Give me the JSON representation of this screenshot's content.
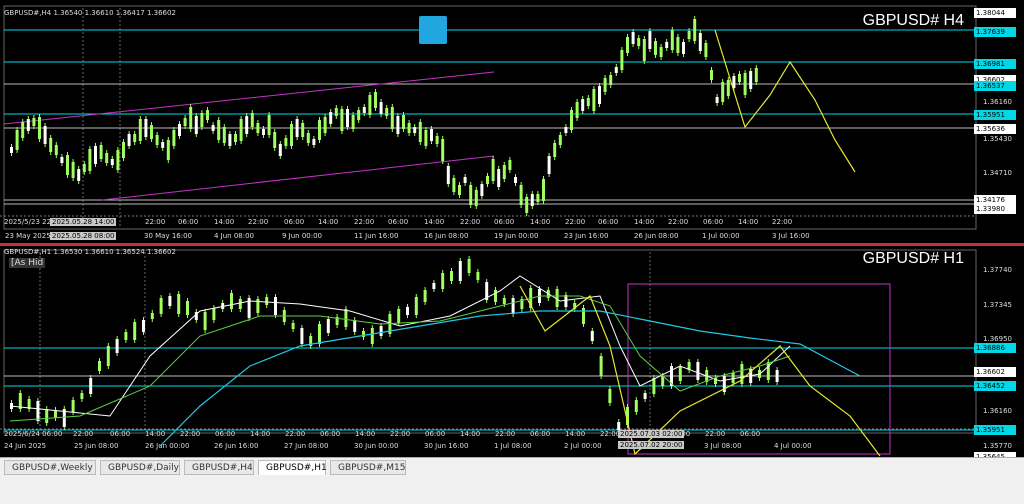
{
  "top_chart": {
    "header": "GBPUSD#,H4  1.36540 1.36610 1.36417 1.36602",
    "symbol_label": "GBPUSD# H4",
    "price_labels": [
      {
        "text": "1.38044",
        "style": "white"
      },
      {
        "text": "1.37639",
        "style": "cyan"
      },
      {
        "text": "1.36981",
        "style": "cyan"
      },
      {
        "text": "1.36602",
        "style": "white"
      },
      {
        "text": "1.36537",
        "style": "cyan"
      },
      {
        "text": "1.35951",
        "style": "cyan"
      },
      {
        "text": "1.35636",
        "style": "white"
      },
      {
        "text": "1.34176",
        "style": "white"
      },
      {
        "text": "1.33980",
        "style": "white"
      }
    ],
    "price_texts": [
      "1.36160",
      "1.35430",
      "1.34710"
    ],
    "time_labels": [
      "23 May 2025",
      "22:00",
      "06:00",
      "14:00",
      "22:00",
      "06:00",
      "14:00",
      "22:00",
      "06:00",
      "14:00",
      "22:00",
      "06:00",
      "14:00",
      "22:00",
      "06:00",
      "14:00",
      "22:00",
      "06:00",
      "14:00",
      "22:00"
    ],
    "time_labels_bottom": [
      "30 May 16:00",
      "4 Jun 08:00",
      "9 Jun 00:00",
      "11 Jun 16:00",
      "16 Jun 08:00",
      "19 Jun 00:00",
      "23 Jun 16:00",
      "26 Jun 08:00",
      "1 Jul 00:00",
      "3 Jul 16:00"
    ],
    "crosshair_labels": [
      "2025/5/23 22:",
      "2025.05.28 14:00",
      "2025.05.28 08:00"
    ]
  },
  "bottom_chart": {
    "header": "GBPUSD#,H1  1.36530 1.36610 1.36524 1.36602",
    "symbol_label": "GBPUSD# H1",
    "as_hide": "[As Hid",
    "price_labels": [
      {
        "text": "1.36886",
        "style": "cyan"
      },
      {
        "text": "1.36602",
        "style": "white"
      },
      {
        "text": "1.36452",
        "style": "cyan"
      },
      {
        "text": "1.35951",
        "style": "cyan"
      },
      {
        "text": "1.35645",
        "style": "white"
      }
    ],
    "price_texts": [
      "1.37740",
      "1.37345",
      "1.36950",
      "1.36160",
      "1.35770"
    ],
    "time_labels_mid": [
      "2025/6/24 06:00",
      "22:00",
      "06:00",
      "14:00",
      "22:00",
      "06:00",
      "14:00",
      "22:00",
      "06:00",
      "14:00",
      "22:00",
      "06:00",
      "14:00",
      "22:00",
      "06:00",
      "14:00",
      "22:00",
      "06:00",
      "14:00",
      "22:00",
      "06:00"
    ],
    "time_labels_bottom": [
      "24 Jun 2025",
      "25 Jun 08:00",
      "26 Jun 00:00",
      "26 Jun 16:00",
      "27 Jun 08:00",
      "30 Jun 00:00",
      "30 Jun 16:00",
      "1 Jul 08:00",
      "2 Jul 00:00",
      "2 Jul 16:00",
      "3 Jul 08:00",
      "4 Jul 00:00"
    ],
    "crosshair_labels": [
      "2025.07.03 02:00",
      "2025.07.02 20:00"
    ]
  },
  "tabs": [
    "GBPUSD#,Weekly",
    "GBPUSD#,Daily",
    "GBPUSD#,H4",
    "GBPUSD#,H1",
    "GBPUSD#,M15"
  ],
  "active_tab": "GBPUSD#,H1",
  "colors": {
    "cyan": "#00d8e8",
    "magenta": "#c832c8",
    "yellow": "#e8e832",
    "candle": "#a0ff60",
    "ma_white": "#ffffff",
    "ma_green": "#60d040",
    "ma_teal": "#20c8e8",
    "divider": "#c83232"
  }
}
